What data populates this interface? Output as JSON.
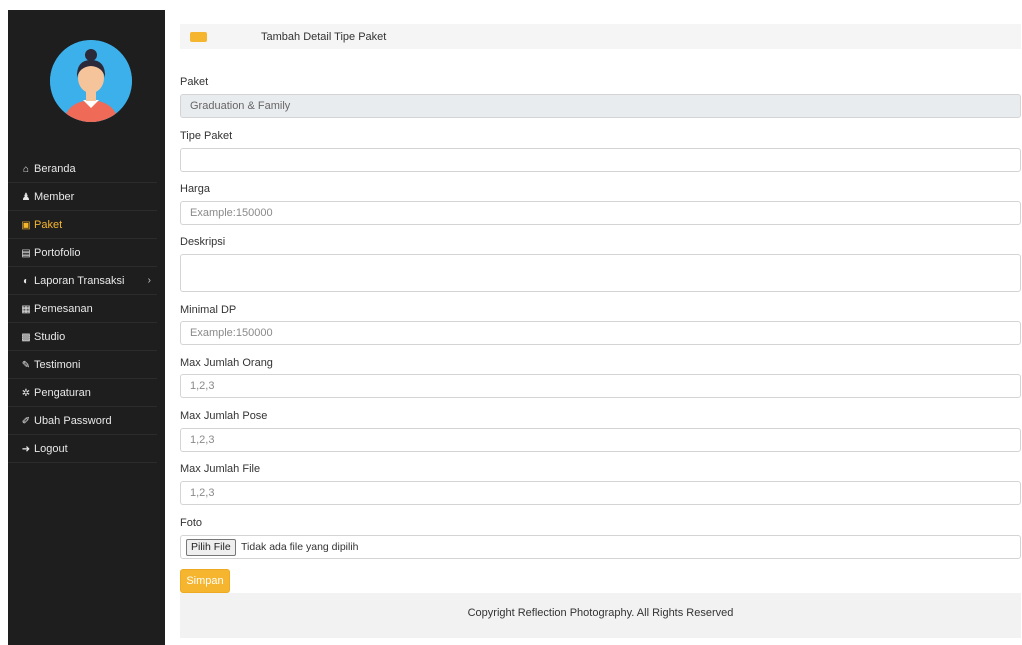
{
  "sidebar": {
    "avatar": "user-avatar",
    "items": [
      {
        "label": "Beranda",
        "icon": "home-icon",
        "glyph": "⌂",
        "active": false
      },
      {
        "label": "Member",
        "icon": "users-icon",
        "glyph": "♟",
        "active": false
      },
      {
        "label": "Paket",
        "icon": "image-icon",
        "glyph": "▣",
        "active": true
      },
      {
        "label": "Portofolio",
        "icon": "book-icon",
        "glyph": "▤",
        "active": false
      },
      {
        "label": "Laporan Transaksi",
        "icon": "report-icon",
        "glyph": "◐",
        "active": false,
        "has_submenu": true
      },
      {
        "label": "Pemesanan",
        "icon": "calendar-icon",
        "glyph": "▦",
        "active": false
      },
      {
        "label": "Studio",
        "icon": "studio-icon",
        "glyph": "▩",
        "active": false
      },
      {
        "label": "Testimoni",
        "icon": "pencil-icon",
        "glyph": "✎",
        "active": false
      },
      {
        "label": "Pengaturan",
        "icon": "gear-icon",
        "glyph": "✲",
        "active": false
      },
      {
        "label": "Ubah Password",
        "icon": "edit-icon",
        "glyph": "✐",
        "active": false
      },
      {
        "label": "Logout",
        "icon": "logout-icon",
        "glyph": "➜",
        "active": false
      }
    ],
    "accent_color": "#f5b52e"
  },
  "header": {
    "title": "Tambah Detail Tipe Paket"
  },
  "form": {
    "paket": {
      "label": "Paket",
      "value": "Graduation & Family"
    },
    "tipe_paket": {
      "label": "Tipe Paket",
      "value": ""
    },
    "harga": {
      "label": "Harga",
      "placeholder": "Example:150000"
    },
    "deskripsi": {
      "label": "Deskripsi",
      "value": ""
    },
    "minimal_dp": {
      "label": "Minimal DP",
      "placeholder": "Example:150000"
    },
    "max_orang": {
      "label": "Max Jumlah Orang",
      "placeholder": "1,2,3"
    },
    "max_pose": {
      "label": "Max Jumlah Pose",
      "placeholder": "1,2,3"
    },
    "max_file": {
      "label": "Max Jumlah File",
      "placeholder": "1,2,3"
    },
    "foto": {
      "label": "Foto",
      "button": "Pilih File",
      "status": "Tidak ada file yang dipilih"
    },
    "submit": "Simpan"
  },
  "footer": {
    "text": "Copyright Reflection Photography. All Rights Reserved"
  }
}
